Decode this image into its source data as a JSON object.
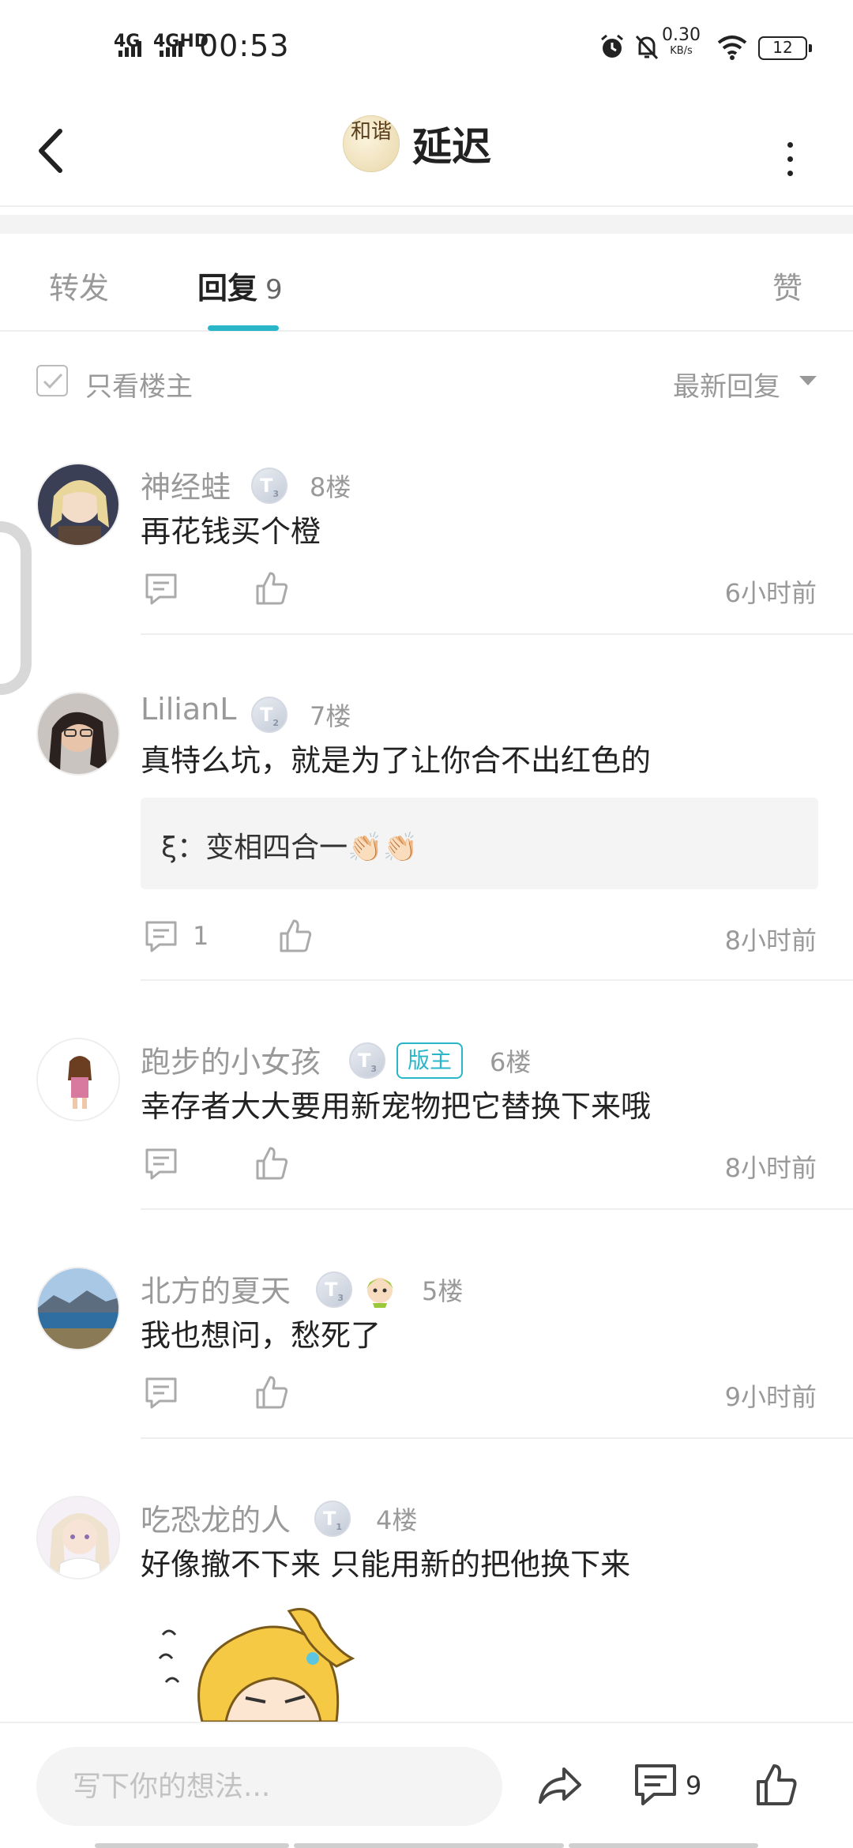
{
  "status_bar": {
    "net1": "4G",
    "net2": "4GHD",
    "time": "00:53",
    "speed_value": "0.30",
    "speed_unit": "KB/s",
    "battery": "12"
  },
  "header": {
    "logo_text": "和谐",
    "title": "延迟"
  },
  "tabs": {
    "repost": "转发",
    "reply": "回复",
    "reply_count": "9",
    "like": "赞"
  },
  "filter": {
    "only_op": "只看楼主",
    "sort": "最新回复"
  },
  "comments": [
    {
      "user": "神经蛙",
      "level": "3",
      "floor": "8楼",
      "text": "再花钱买个橙",
      "time": "6小时前"
    },
    {
      "user": "LilianL",
      "level": "2",
      "floor": "7楼",
      "text": "真特么坑，就是为了让你合不出红色的",
      "quote": "ξ：变相四合一👏🏻👏🏻",
      "reply_count": "1",
      "time": "8小时前"
    },
    {
      "user": "跑步的小女孩",
      "level": "3",
      "mod": "版主",
      "floor": "6楼",
      "text": "幸存者大大要用新宠物把它替换下来哦",
      "time": "8小时前"
    },
    {
      "user": "北方的夏天",
      "level": "3",
      "floor": "5楼",
      "text": "我也想问，愁死了",
      "time": "9小时前"
    },
    {
      "user": "吃恐龙的人",
      "level": "1",
      "floor": "4楼",
      "text": "好像撤不下来  只能用新的把他换下来"
    }
  ],
  "bottom_bar": {
    "placeholder": "写下你的想法...",
    "comment_count": "9"
  },
  "colors": {
    "accent": "#29b6c8",
    "muted_text": "#999999",
    "primary_text": "#222222"
  }
}
